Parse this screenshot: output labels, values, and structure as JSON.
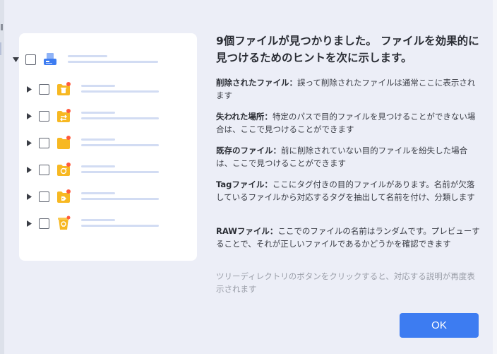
{
  "dialog": {
    "headline": "9個ファイルが見つかりました。 ファイルを効果的に見つけるためのヒントを次に示します。",
    "entries": [
      {
        "term": "削除されたファイル：",
        "desc": "誤って削除されたファイルは通常ここに表示されます"
      },
      {
        "term": "失われた場所：",
        "desc": "特定のパスで目的ファイルを見つけることができない場合は、ここで見つけることができます"
      },
      {
        "term": "既存のファイル：",
        "desc": "前に削除されていない目的ファイルを紛失した場合は、ここで見つけることができます"
      },
      {
        "term": "Tagファイル：",
        "desc": "ここにタグ付きの目的ファイルがあります。名前が欠落しているファイルから対応するタグを抽出して名前を付け、分類します"
      },
      {
        "term": "RAWファイル：",
        "desc": "ここでのファイルの名前はランダムです。プレビューすることで、それが正しいファイルであるかどうかを確認できます"
      }
    ],
    "hint": "ツリーディレクトリのボタンをクリックすると、対応する説明が再度表示されます",
    "ok_label": "OK"
  },
  "tree": {
    "root_icon": "drive-icon",
    "children_icons": [
      "deleted-folder-icon",
      "lost-location-folder-icon",
      "existing-folder-icon",
      "tag-folder-icon",
      "tag-label-folder-icon",
      "raw-files-icon"
    ],
    "colors": {
      "folder": "#f7b822",
      "folder_dot": "#ff5a3c",
      "drive": "#3d7cf1",
      "placeholder": "#d2dcf3"
    }
  },
  "colors": {
    "accent": "#3d7cf1",
    "dialog_bg": "#eceef7",
    "panel_bg": "#ffffff"
  }
}
